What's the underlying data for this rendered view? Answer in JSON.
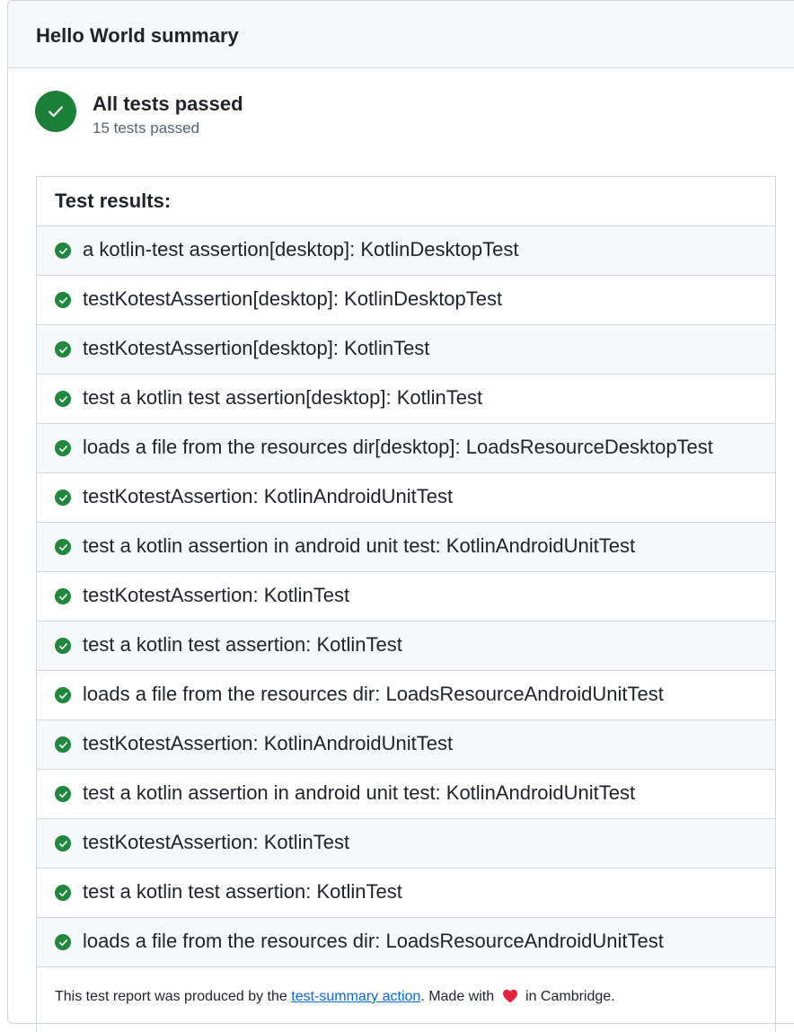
{
  "summary": {
    "title": "Hello World summary",
    "status_title": "All tests passed",
    "status_subtitle": "15 tests passed",
    "status_color": "#1a7f37",
    "status_icon": "check-circle-icon"
  },
  "results": {
    "header": "Test results:",
    "row_icon": "check-circle-icon",
    "row_icon_color": "#1f883d",
    "rows": [
      "a kotlin-test assertion[desktop]: KotlinDesktopTest",
      "testKotestAssertion[desktop]: KotlinDesktopTest",
      "testKotestAssertion[desktop]: KotlinTest",
      "test a kotlin test assertion[desktop]: KotlinTest",
      "loads a file from the resources dir[desktop]: LoadsResourceDesktopTest",
      "testKotestAssertion: KotlinAndroidUnitTest",
      "test a kotlin assertion in android unit test: KotlinAndroidUnitTest",
      "testKotestAssertion: KotlinTest",
      "test a kotlin test assertion: KotlinTest",
      "loads a file from the resources dir: LoadsResourceAndroidUnitTest",
      "testKotestAssertion: KotlinAndroidUnitTest",
      "test a kotlin assertion in android unit test: KotlinAndroidUnitTest",
      "testKotestAssertion: KotlinTest",
      "test a kotlin test assertion: KotlinTest",
      "loads a file from the resources dir: LoadsResourceAndroidUnitTest"
    ]
  },
  "footer": {
    "prefix": "This test report was produced by the ",
    "link_text": "test-summary action",
    "middle": ".  Made with",
    "suffix": "in Cambridge.",
    "heart_icon": "heart-icon",
    "link_color": "#0969da",
    "heart_color": "#e5243b"
  }
}
